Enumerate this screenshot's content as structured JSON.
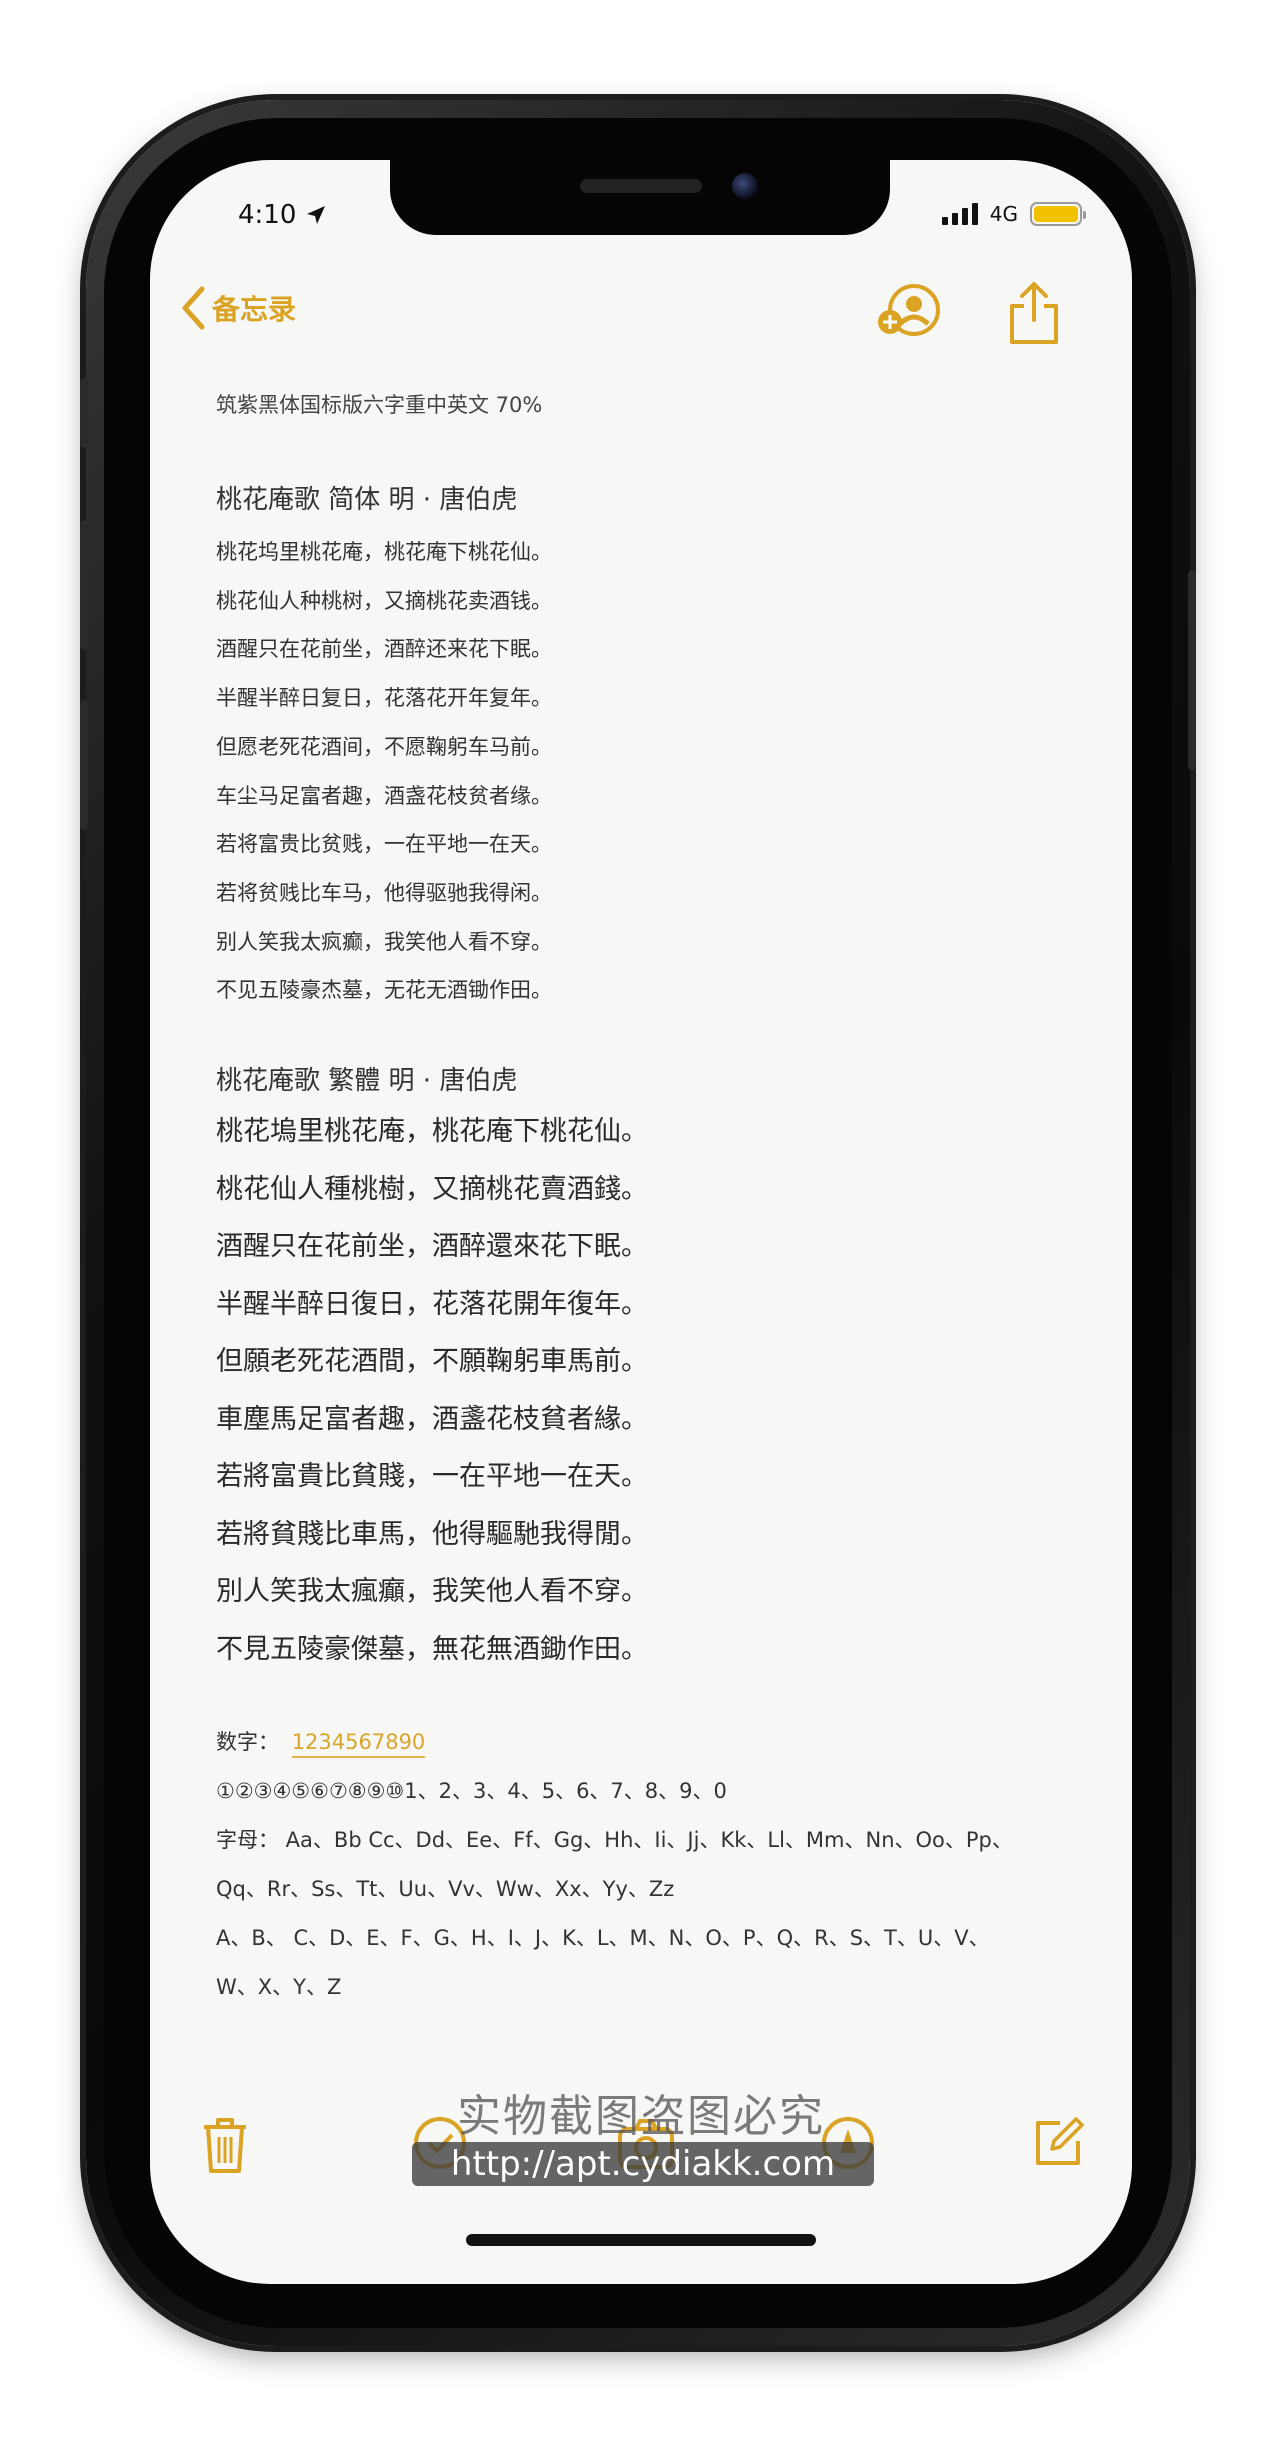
{
  "status": {
    "time": "4:10",
    "network": "4G",
    "battery_color": "#f2c200"
  },
  "nav": {
    "back_label": "备忘录",
    "accent": "#dba324",
    "icons": [
      "chevron-left-icon",
      "add-person-icon",
      "share-icon"
    ]
  },
  "note": {
    "font_description": "筑紫黑体国标版六字重中英文 70%",
    "simplified": {
      "title": "桃花庵歌  简体    明  ·  唐伯虎",
      "lines": [
        "桃花坞里桃花庵，桃花庵下桃花仙。",
        "桃花仙人种桃树，又摘桃花卖酒钱。",
        "酒醒只在花前坐，酒醉还来花下眠。",
        "半醒半醉日复日，花落花开年复年。",
        "但愿老死花酒间，不愿鞠躬车马前。",
        "车尘马足富者趣，酒盏花枝贫者缘。",
        "若将富贵比贫贱，一在平地一在天。",
        "若将贫贱比车马，他得驱驰我得闲。",
        "别人笑我太疯癫，我笑他人看不穿。",
        "不见五陵豪杰墓，无花无酒锄作田。"
      ]
    },
    "traditional": {
      "title": "桃花庵歌  繁體        明  ·  唐伯虎",
      "lines": [
        "桃花塢里桃花庵，桃花庵下桃花仙。",
        "桃花仙人種桃樹，又摘桃花賣酒錢。",
        "酒醒只在花前坐，酒醉還來花下眠。",
        "半醒半醉日復日，花落花開年復年。",
        "但願老死花酒間，不願鞠躬車馬前。",
        "車塵馬足富者趣，酒盞花枝貧者緣。",
        "若將富貴比貧賤，一在平地一在天。",
        "若將貧賤比車馬，他得驅馳我得閒。",
        "別人笑我太瘋癲，我笑他人看不穿。",
        "不見五陵豪傑墓，無花無酒鋤作田。"
      ]
    },
    "digits_label": "数字：",
    "digits_value": "1234567890",
    "digit_line": "①②③④⑤⑥⑦⑧⑨⑩1、2、3、4、5、6、7、8、9、0",
    "letters_line_1": "字母：  Aa、Bb Cc、Dd、Ee、Ff、Gg、Hh、Ii、Jj、Kk、Ll、Mm、Nn、Oo、Pp、",
    "letters_line_2": "Qq、Rr、Ss、Tt、Uu、Vv、Ww、Xx、Yy、Zz",
    "upper_line_1": "A、B、 C、D、E、F、G、H、I、J、K、L、M、N、O、P、Q、R、S、T、U、V、",
    "upper_line_2": "W、X、Y、Z"
  },
  "watermark": {
    "text": "实物截图盗图必究",
    "url": "http://apt.cydiakk.com"
  },
  "toolbar": {
    "icons": [
      "trash-icon",
      "checklist-icon",
      "camera-icon",
      "markup-icon",
      "compose-icon"
    ]
  }
}
